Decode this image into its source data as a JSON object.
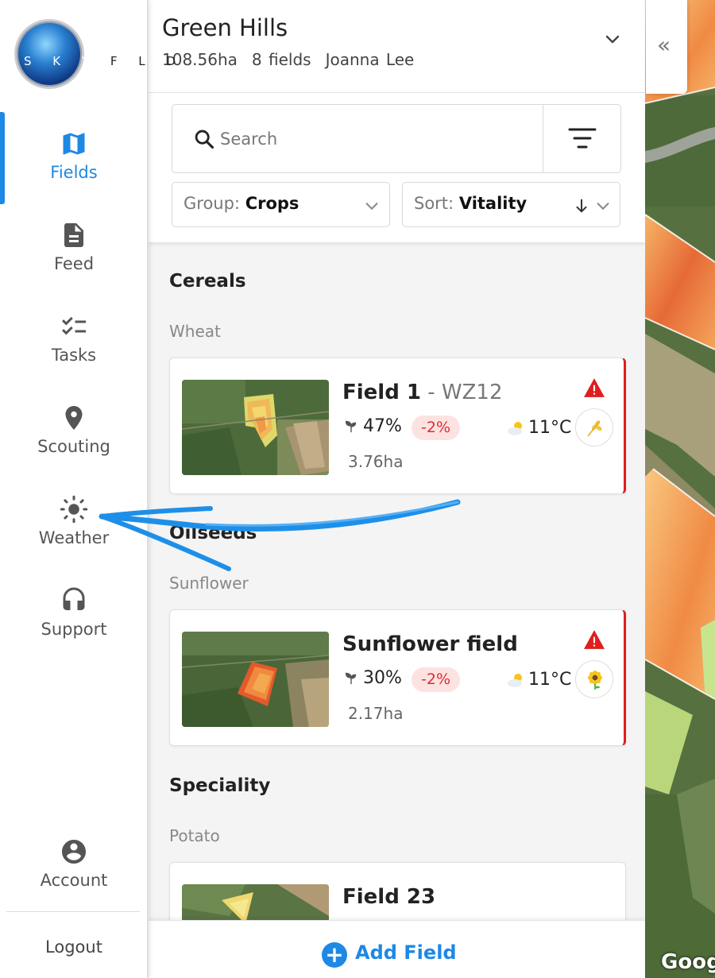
{
  "brand": {
    "logo_left": "S K Y",
    "logo_right": "F L D"
  },
  "nav": {
    "items": [
      {
        "label": "Fields",
        "icon": "map-icon",
        "active": true
      },
      {
        "label": "Feed",
        "icon": "document-icon"
      },
      {
        "label": "Tasks",
        "icon": "checklist-icon"
      },
      {
        "label": "Scouting",
        "icon": "location-pin-icon"
      },
      {
        "label": "Weather",
        "icon": "sun-icon"
      },
      {
        "label": "Support",
        "icon": "headset-icon"
      }
    ],
    "account": {
      "label": "Account",
      "icon": "account-icon"
    },
    "logout": "Logout",
    "accent_color": "#1e88e5"
  },
  "farm": {
    "name": "Green Hills",
    "area": "108.56ha",
    "fields": "8 fields",
    "owner": "Joanna Lee"
  },
  "search": {
    "placeholder": "Search",
    "value": ""
  },
  "controls": {
    "group_label": "Group:",
    "group_value": "Crops",
    "sort_label": "Sort:",
    "sort_value": "Vitality"
  },
  "groups": [
    {
      "title": "Cereals",
      "crop": "Wheat",
      "card": {
        "name": "Field 1",
        "code": "- WZ12",
        "vitality": "47%",
        "delta": "-2%",
        "temp": "11°C",
        "area": "3.76ha",
        "crop_icon": "wheat-icon",
        "alert": true
      }
    },
    {
      "title": "Oilseeds",
      "crop": "Sunflower",
      "card": {
        "name": "Sunflower field",
        "code": "",
        "vitality": "30%",
        "delta": "-2%",
        "temp": "11°C",
        "area": "2.17ha",
        "crop_icon": "sunflower-icon",
        "alert": true
      }
    },
    {
      "title": "Speciality",
      "crop": "Potato",
      "card": {
        "name": "Field 23",
        "code": ""
      }
    }
  ],
  "add_field": "Add Field",
  "map": {
    "collapse": "«",
    "attribution": "Goog"
  },
  "colors": {
    "alert": "#e01e1e",
    "delta_bg": "#fde2e2",
    "delta_text": "#d93030"
  }
}
